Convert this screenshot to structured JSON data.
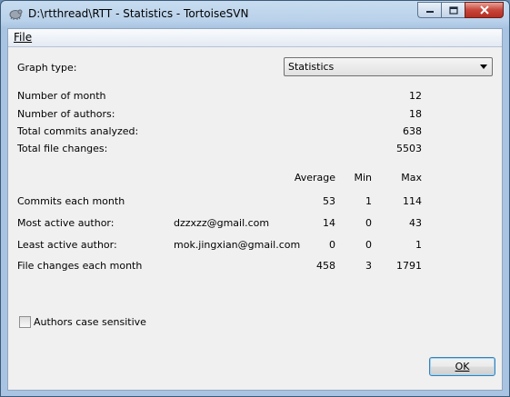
{
  "window": {
    "title": "D:\\rtthread\\RTT - Statistics - TortoiseSVN"
  },
  "menu": {
    "file_label": "File"
  },
  "graph_type": {
    "label": "Graph type:",
    "value": "Statistics"
  },
  "summary": [
    {
      "label": "Number of month",
      "value": "12"
    },
    {
      "label": "Number of authors:",
      "value": "18"
    },
    {
      "label": "Total commits analyzed:",
      "value": "638"
    },
    {
      "label": "Total file changes:",
      "value": "5503"
    }
  ],
  "table": {
    "headers": {
      "average": "Average",
      "min": "Min",
      "max": "Max"
    },
    "rows": [
      {
        "label": "Commits each month",
        "author": "",
        "average": "53",
        "min": "1",
        "max": "114"
      },
      {
        "label": "Most active author:",
        "author": "dzzxzz@gmail.com",
        "average": "14",
        "min": "0",
        "max": "43"
      },
      {
        "label": "Least active author:",
        "author": "mok.jingxian@gmail.com",
        "average": "0",
        "min": "0",
        "max": "1"
      },
      {
        "label": "File changes each month",
        "author": "",
        "average": "458",
        "min": "3",
        "max": "1791"
      }
    ]
  },
  "options": {
    "authors_case_sensitive": {
      "label": "Authors case sensitive",
      "checked": false
    }
  },
  "buttons": {
    "ok_label": "OK"
  }
}
